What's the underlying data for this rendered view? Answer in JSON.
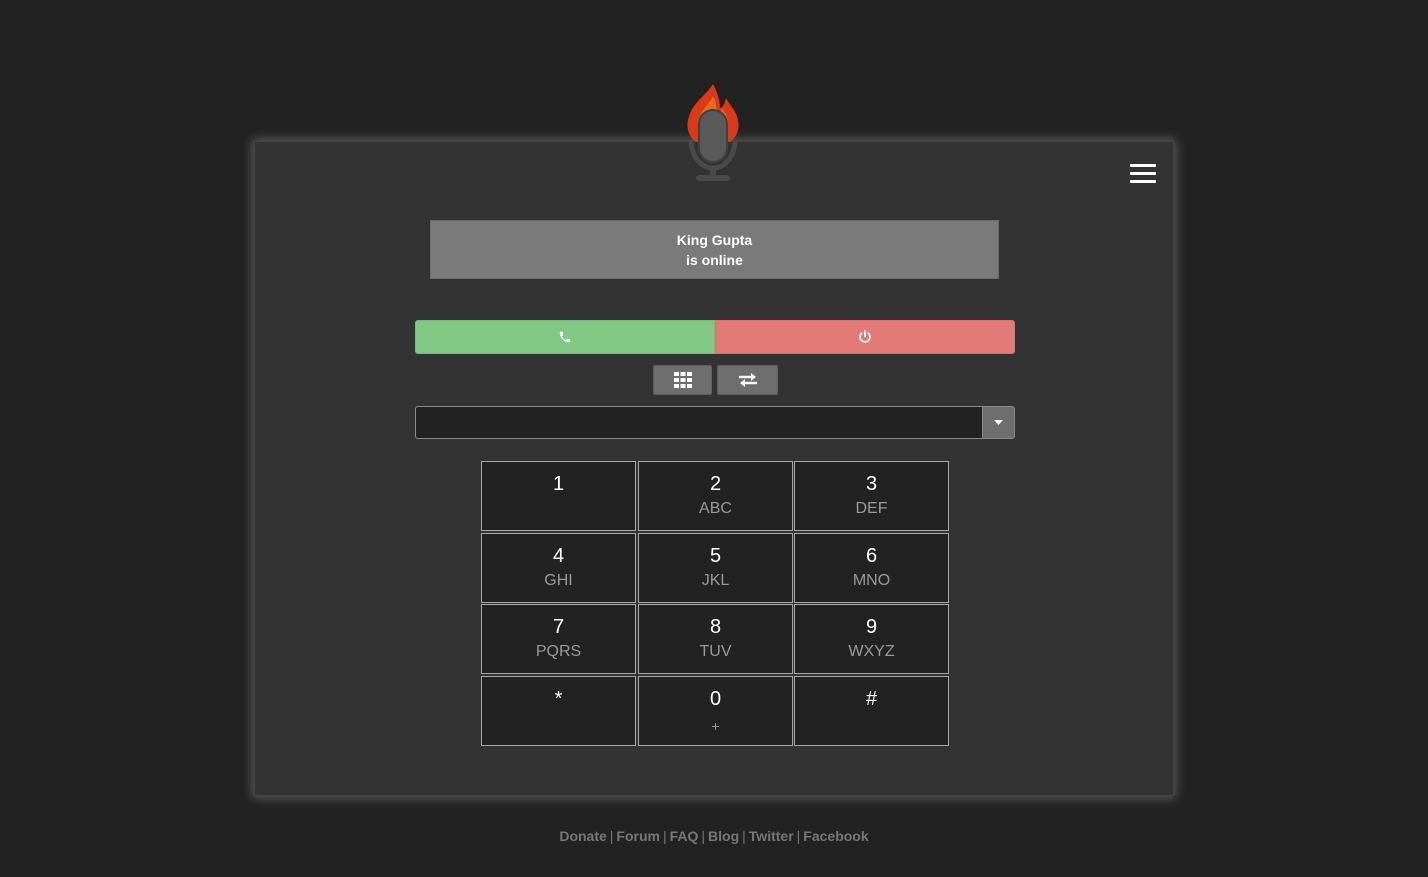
{
  "app": {
    "brand_color": "#d93a1a",
    "logo_icon": "flame-microphone-icon"
  },
  "header": {
    "menu_icon": "hamburger-menu-icon"
  },
  "status": {
    "name": "King Gupta",
    "state": "is online"
  },
  "controls": {
    "call_icon": "phone-icon",
    "hangup_icon": "power-icon",
    "call_color": "#80c883",
    "hangup_color": "#e27a78",
    "keypad_toggle_icon": "keypad-grid-icon",
    "transfer_icon": "transfer-arrows-icon"
  },
  "number_input": {
    "value": "",
    "placeholder": "",
    "dropdown_icon": "caret-down-icon"
  },
  "keypad": {
    "keys": [
      {
        "digit": "1",
        "letters": ""
      },
      {
        "digit": "2",
        "letters": "ABC"
      },
      {
        "digit": "3",
        "letters": "DEF"
      },
      {
        "digit": "4",
        "letters": "GHI"
      },
      {
        "digit": "5",
        "letters": "JKL"
      },
      {
        "digit": "6",
        "letters": "MNO"
      },
      {
        "digit": "7",
        "letters": "PQRS"
      },
      {
        "digit": "8",
        "letters": "TUV"
      },
      {
        "digit": "9",
        "letters": "WXYZ"
      },
      {
        "digit": "*",
        "letters": ""
      },
      {
        "digit": "0",
        "letters": "+"
      },
      {
        "digit": "#",
        "letters": ""
      }
    ]
  },
  "footer": {
    "links": [
      "Donate",
      "Forum",
      "FAQ",
      "Blog",
      "Twitter",
      "Facebook"
    ],
    "separator": "|"
  }
}
